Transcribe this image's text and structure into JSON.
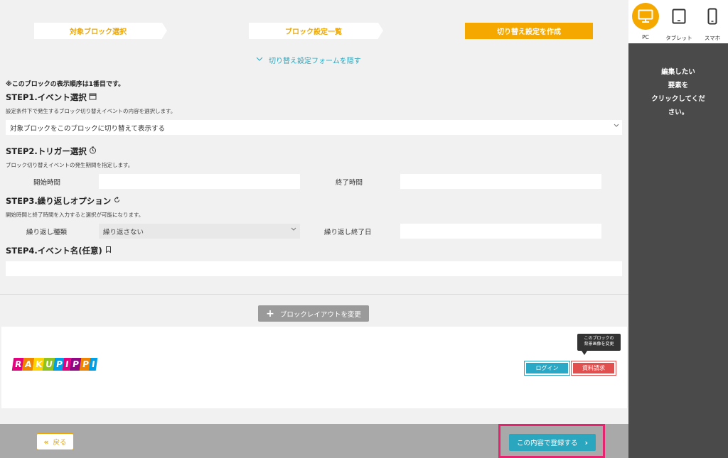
{
  "steps": [
    {
      "label": "対象ブロック選択",
      "active": false
    },
    {
      "label": "ブロック設定一覧",
      "active": false
    },
    {
      "label": "切り替え設定を作成",
      "active": true
    }
  ],
  "hide_form": {
    "label": "切り替え設定フォームを隠す",
    "icon": "chevron-down-icon"
  },
  "order_note": "※このブロックの表示順序は1番目です。",
  "step1": {
    "title": "STEP1.イベント選択",
    "icon": "calendar-icon",
    "desc": "設定条件下で発生するブロック切り替えイベントの内容を選択します。",
    "select_value": "対象ブロックをこのブロックに切り替えて表示する"
  },
  "step2": {
    "title": "STEP2.トリガー選択",
    "icon": "clock-icon",
    "desc": "ブロック切り替えイベントの発生期間を指定します。",
    "start_label": "開始時間",
    "end_label": "終了時間",
    "start_value": "",
    "end_value": ""
  },
  "step3": {
    "title": "STEP3.繰り返しオプション",
    "icon": "repeat-icon",
    "desc": "開始時間と終了時間を入力すると選択が可能になります。",
    "type_label": "繰り返し種類",
    "type_value": "繰り返さない",
    "end_label": "繰り返し終了日",
    "end_value": ""
  },
  "step4": {
    "title": "STEP4.イベント名(任意)",
    "icon": "bookmark-icon",
    "value": ""
  },
  "layout_button": {
    "label": "ブロックレイアウトを変更",
    "icon": "plus-icon"
  },
  "preview": {
    "logo_letters": [
      "R",
      "A",
      "K",
      "U",
      "P",
      "I",
      "P",
      "P",
      "I"
    ],
    "logo_colors": [
      "#e4007f",
      "#f08300",
      "#ffd400",
      "#8fc31f",
      "#00a0e9",
      "#e4007f",
      "#920783",
      "#f08300",
      "#00a0e9"
    ],
    "tooltip_line1": "このブロックの",
    "tooltip_line2": "背景画像を変更",
    "login_label": "ログイン",
    "request_label": "資料請求"
  },
  "footer": {
    "back_label": "戻る",
    "register_label": "この内容で登録する"
  },
  "devices": [
    {
      "label": "PC",
      "icon": "desktop-icon",
      "active": true
    },
    {
      "label": "タブレット",
      "icon": "tablet-icon",
      "active": false
    },
    {
      "label": "スマホ",
      "icon": "smartphone-icon",
      "active": false
    }
  ],
  "instruction": [
    "編集したい",
    "要素を",
    "クリックしてくだ",
    "さい。"
  ],
  "colors": {
    "accent": "#f5a800",
    "teal": "#2aa6bf",
    "red": "#e24f4f",
    "highlight": "#e5236f"
  }
}
